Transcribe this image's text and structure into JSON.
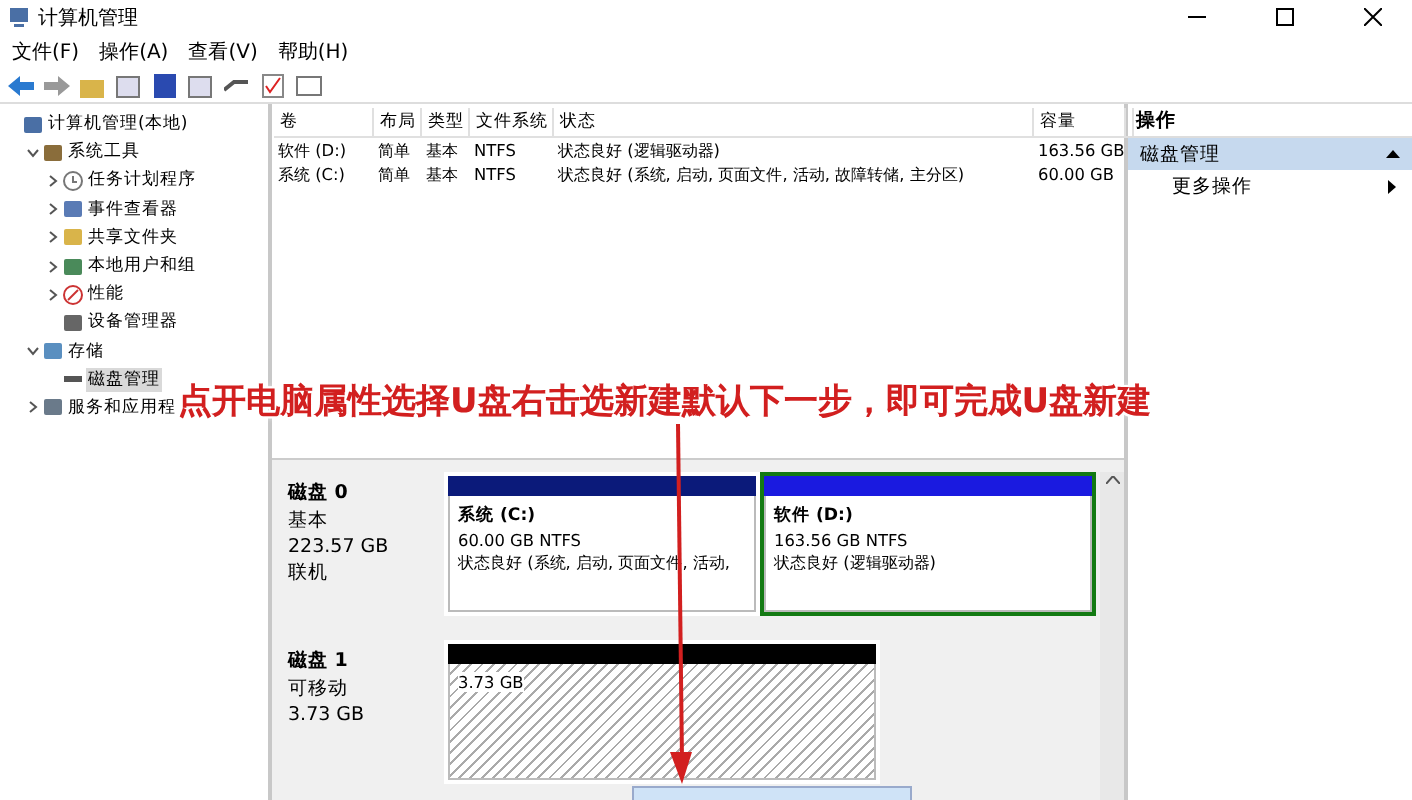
{
  "window": {
    "title": "计算机管理"
  },
  "menu": [
    "文件(F)",
    "操作(A)",
    "查看(V)",
    "帮助(H)"
  ],
  "tree": [
    {
      "label": "计算机管理(本地)",
      "selected": false,
      "children": [
        {
          "label": "系统工具",
          "expanded": true,
          "selected": false,
          "children": [
            {
              "label": "任务计划程序",
              "expanded": false,
              "selected": false
            },
            {
              "label": "事件查看器",
              "expanded": false,
              "selected": false
            },
            {
              "label": "共享文件夹",
              "expanded": false,
              "selected": false
            },
            {
              "label": "本地用户和组",
              "expanded": false,
              "selected": false
            },
            {
              "label": "性能",
              "expanded": false,
              "selected": false
            },
            {
              "label": "设备管理器",
              "selected": false
            }
          ]
        },
        {
          "label": "存储",
          "expanded": true,
          "selected": false,
          "children": [
            {
              "label": "磁盘管理",
              "selected": true
            }
          ]
        },
        {
          "label": "服务和应用程",
          "expanded": false,
          "selected": false
        }
      ]
    }
  ],
  "volumes": {
    "columns": [
      "卷",
      "布局",
      "类型",
      "文件系统",
      "状态",
      "容量"
    ],
    "rows": [
      [
        "软件 (D:)",
        "简单",
        "基本",
        "NTFS",
        "状态良好 (逻辑驱动器)",
        "163.56 GB"
      ],
      [
        "系统 (C:)",
        "简单",
        "基本",
        "NTFS",
        "状态良好 (系统, 启动, 页面文件, 活动, 故障转储, 主分区)",
        "60.00 GB"
      ]
    ]
  },
  "disks": [
    {
      "name": "磁盘 0",
      "type": "基本",
      "size": "223.57 GB",
      "status": "联机",
      "partitions": [
        {
          "kind": "primary",
          "name": "系统  (C:)",
          "size": "60.00 GB NTFS",
          "state": "状态良好 (系统, 启动, 页面文件, 活动,",
          "selected": false
        },
        {
          "kind": "logical",
          "name": "软件  (D:)",
          "size": "163.56 GB NTFS",
          "state": "状态良好 (逻辑驱动器)",
          "selected": true
        }
      ]
    },
    {
      "name": "磁盘 1",
      "type": "可移动",
      "size": "3.73 GB",
      "partitions": [
        {
          "kind": "unallocated",
          "size": "3.73 GB",
          "selected": false
        }
      ]
    }
  ],
  "actions": {
    "header": "操作",
    "section": "磁盘管理",
    "items": [
      "更多操作"
    ]
  },
  "annotation": "点开电脑属性选择U盘右击选新建默认下一步，即可完成U盘新建"
}
